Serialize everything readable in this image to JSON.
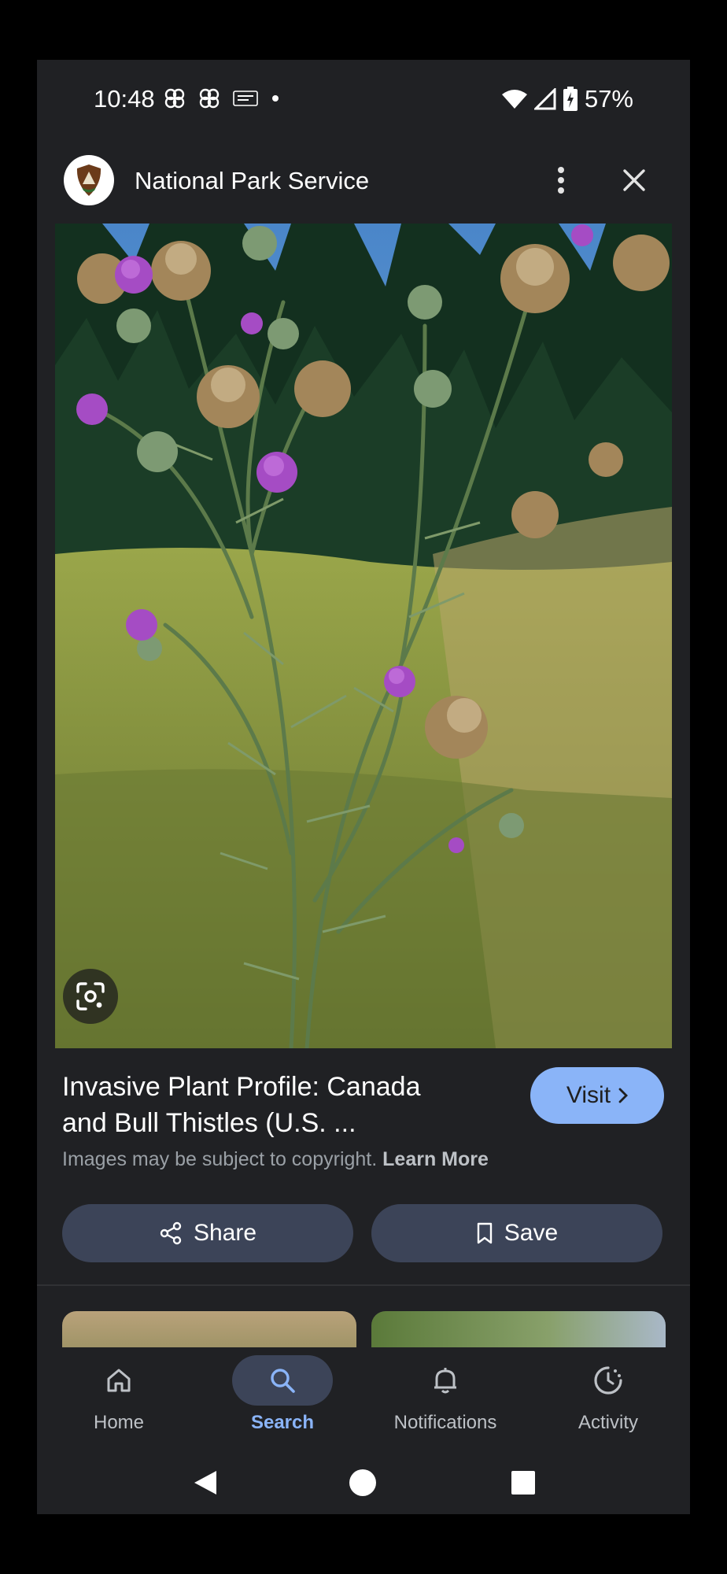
{
  "status_bar": {
    "time": "10:48",
    "battery": "57%",
    "notification_icons": [
      "pinwheel-icon",
      "pinwheel-icon",
      "nbc-news-icon",
      "dot-icon"
    ],
    "right_icons": [
      "wifi-icon",
      "signal-icon",
      "battery-charging-icon"
    ]
  },
  "header": {
    "site_name": "National Park Service",
    "logo": "nps-arrowhead-logo"
  },
  "image_card": {
    "title": "Invasive Plant Profile: Canada and Bull Thistles (U.S. ...",
    "visit_label": "Visit",
    "copyright_text": "Images may be subject to copyright.",
    "learn_more": "Learn More",
    "share_label": "Share",
    "save_label": "Save"
  },
  "bottom_nav": {
    "items": [
      {
        "label": "Home",
        "icon": "home-icon"
      },
      {
        "label": "Search",
        "icon": "search-icon"
      },
      {
        "label": "Notifications",
        "icon": "bell-icon"
      },
      {
        "label": "Activity",
        "icon": "activity-icon"
      }
    ],
    "active": "Search"
  },
  "colors": {
    "background": "#202124",
    "accent": "#8ab4f8",
    "pill": "#3c4458"
  }
}
